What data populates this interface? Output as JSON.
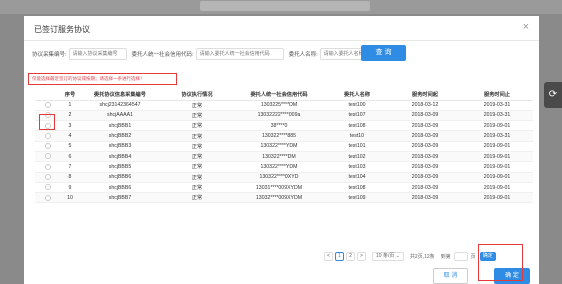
{
  "modal": {
    "title": "已签订服务协议",
    "close": "×"
  },
  "search": {
    "code_label": "协议采集编号:",
    "code_placeholder": "请输入协议采集编号",
    "credit_label": "委托人统一社会信用代码:",
    "credit_placeholder": "请输入委托人统一社会信用代码",
    "name_label": "委托人名称:",
    "name_placeholder": "请输入委托人名称",
    "button": "查 询"
  },
  "notice": "仅能选择最近签订的协议或按期；请选择一条进行选择！",
  "table": {
    "headers": [
      "",
      "序号",
      "委托协议信息采集编号",
      "协议执行情况",
      "委托人统一社会信用代码",
      "委托人名称",
      "服务时间起",
      "服务时间止"
    ],
    "rows": [
      [
        "1",
        "shcj23142364547",
        "正常",
        "1303225****DM",
        "test100",
        "2018-03-12",
        "2019-03-31"
      ],
      [
        "2",
        "shcjAAAA1",
        "正常",
        "13032222****009a",
        "test107",
        "2018-03-09",
        "2019-03-31"
      ],
      [
        "3",
        "shcjBBB1",
        "正常",
        "38****0",
        "test108",
        "2018-03-09",
        "2019-09-01"
      ],
      [
        "4",
        "shcjBBB2",
        "正常",
        "130322****885",
        "test10",
        "2018-03-09",
        "2019-03-31"
      ],
      [
        "5",
        "shcjBBB3",
        "正常",
        "130322****YDM",
        "test101",
        "2018-03-09",
        "2019-09-01"
      ],
      [
        "6",
        "shcjBBB4",
        "正常",
        "130322****DM",
        "test102",
        "2018-03-09",
        "2019-09-01"
      ],
      [
        "7",
        "shcjBBB5",
        "正常",
        "130322****YDM",
        "test103",
        "2018-03-09",
        "2019-09-01"
      ],
      [
        "8",
        "shcjBBB6",
        "正常",
        "130322****0XYD",
        "test104",
        "2018-03-09",
        "2019-09-01"
      ],
      [
        "9",
        "shcjBBB6",
        "正常",
        "13031****009XYDM",
        "test108",
        "2018-03-09",
        "2019-09-01"
      ],
      [
        "10",
        "shcjBBB7",
        "正常",
        "13032****009XYDM",
        "test109",
        "2018-03-09",
        "2019-09-01"
      ]
    ]
  },
  "pagination": {
    "prev": "<",
    "page1": "1",
    "page2": "2",
    "next": ">",
    "size": "10 条/页 ⌄",
    "total": "共2页,12条",
    "jump": "到第",
    "page_unit": "页",
    "confirm": "确定"
  },
  "footer": {
    "cancel": "取 消",
    "ok": "确 定"
  }
}
